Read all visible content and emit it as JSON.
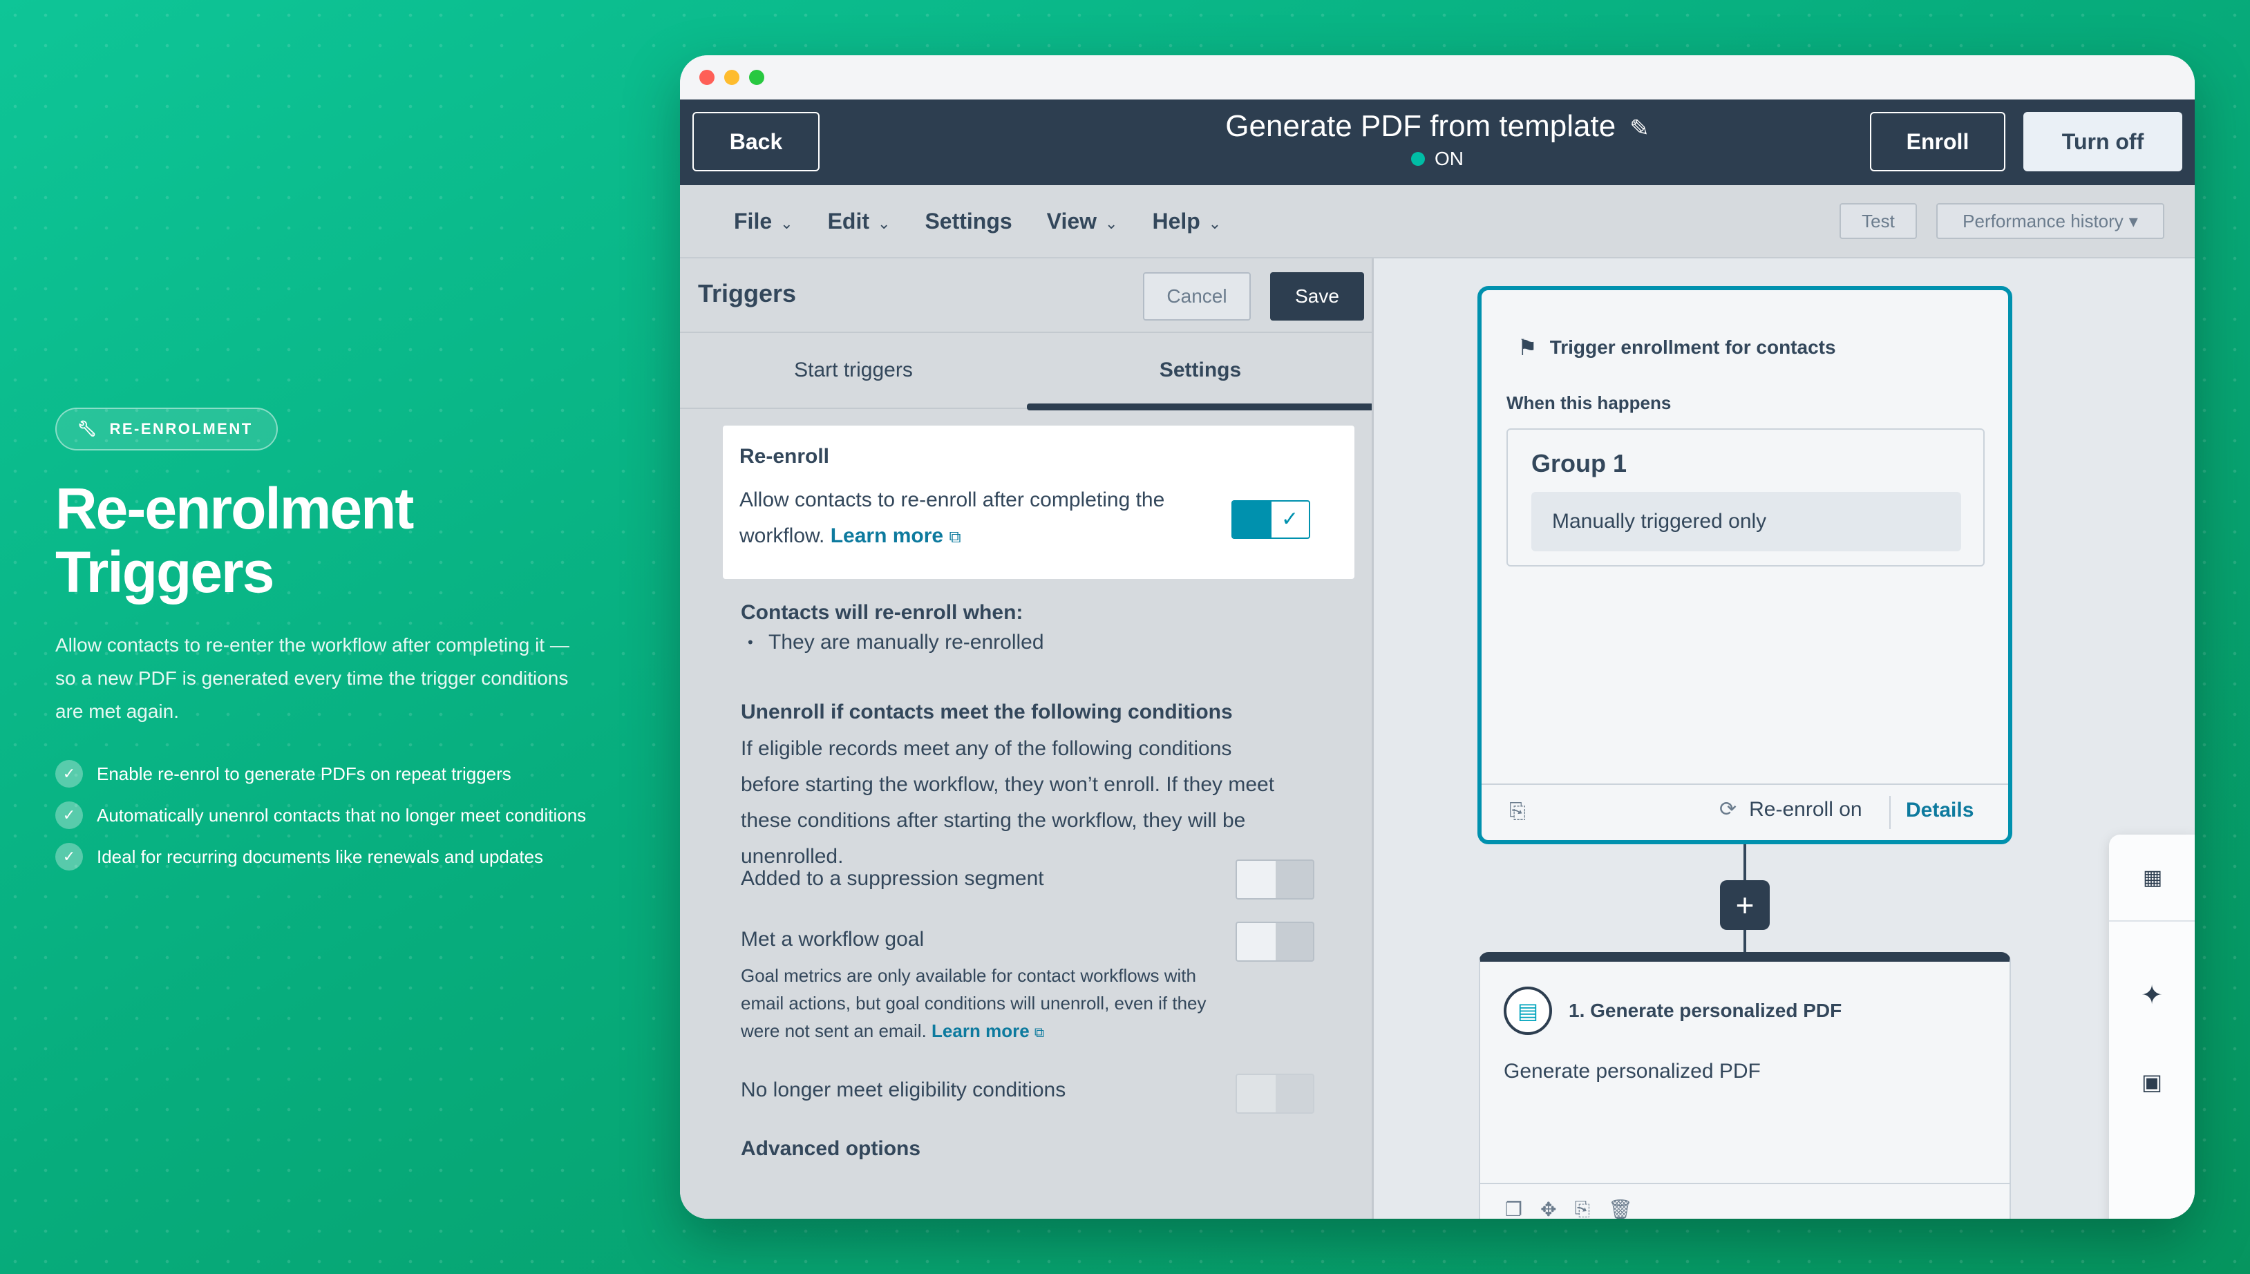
{
  "badge": {
    "icon": "wrench-icon",
    "label": "RE-ENROLMENT"
  },
  "hero": {
    "line1": "Re-enrolment",
    "line2": "Triggers"
  },
  "description": "Allow contacts to re-enter the workflow after completing it — so a new PDF is generated every time the trigger conditions are met again.",
  "features": [
    "Enable re-enrol to generate PDFs on repeat triggers",
    "Automatically unenrol contacts that no longer meet conditions",
    "Ideal for recurring documents like renewals and updates"
  ],
  "colors": {
    "brand_bg": "#07a777",
    "accent": "#0091ae",
    "dark": "#2d3e50",
    "text": "#33475b"
  },
  "window": {
    "back": "Back",
    "title": "Generate PDF from template",
    "status": "ON",
    "enroll": "Enroll",
    "turn_off": "Turn off",
    "menu": {
      "file": "File",
      "edit": "Edit",
      "settings": "Settings",
      "view": "View",
      "help": "Help"
    },
    "test": "Test",
    "performance_history": "Performance history"
  },
  "triggers": {
    "title": "Triggers",
    "cancel": "Cancel",
    "save": "Save",
    "tabs": {
      "start": "Start triggers",
      "settings": "Settings"
    },
    "reenroll": {
      "heading": "Re-enroll",
      "text": "Allow contacts to re-enroll after completing the workflow.",
      "learn_more": "Learn more",
      "enabled": true
    },
    "will_reenroll_heading": "Contacts will re-enroll when:",
    "will_reenroll_item": "They are manually re-enrolled",
    "unenroll_heading": "Unenroll if contacts meet the following conditions",
    "unenroll_text": "If eligible records meet any of the following conditions before starting the workflow, they won’t enroll. If they meet these conditions after starting the workflow, they will be unenrolled.",
    "suppression": "Added to a suppression segment",
    "goal": "Met a workflow goal",
    "goal_note": "Goal metrics are only available for contact workflows with email actions, but goal conditions will unenroll, even if they were not sent an email.",
    "goal_learn_more": "Learn more",
    "eligibility": "No longer meet eligibility conditions",
    "advanced": "Advanced options"
  },
  "canvas": {
    "trigger_card": {
      "title": "Trigger enrollment for contacts",
      "when": "When this happens",
      "group_title": "Group 1",
      "group_item": "Manually triggered only",
      "reenroll_on": "Re-enroll on",
      "details": "Details"
    },
    "action_card": {
      "title": "1. Generate personalized PDF",
      "body": "Generate personalized PDF"
    }
  }
}
